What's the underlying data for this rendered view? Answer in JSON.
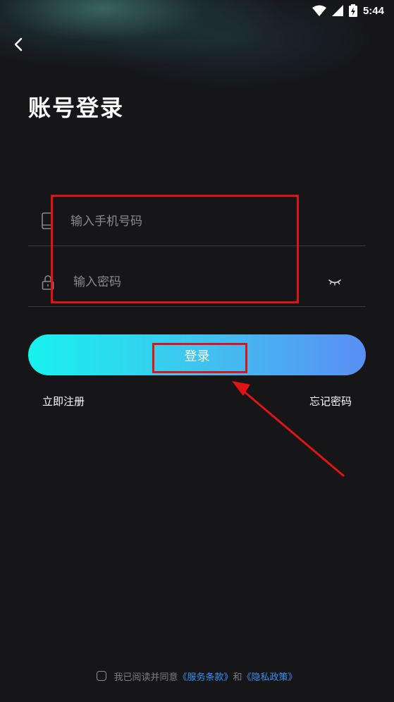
{
  "status_bar": {
    "time": "5:44"
  },
  "page": {
    "title": "账号登录"
  },
  "form": {
    "phone_placeholder": "输入手机号码",
    "password_placeholder": "输入密码",
    "login_label": "登录"
  },
  "links": {
    "register": "立即注册",
    "forgot": "忘记密码"
  },
  "agreement": {
    "prefix": "我已阅读并同意",
    "terms_link": "《服务条款》",
    "conjunction": "和",
    "privacy_link": "《隐私政策》",
    "checked": false
  },
  "colors": {
    "background": "#161619",
    "button_gradient_start": "#17f2ee",
    "button_gradient_end": "#5a8ef4",
    "link": "#3a8ff0",
    "annotation": "#e01414"
  },
  "icons": [
    "back-arrow-icon",
    "phone-icon",
    "lock-icon",
    "eye-closed-icon",
    "wifi-icon",
    "cellular-icon",
    "battery-icon"
  ]
}
